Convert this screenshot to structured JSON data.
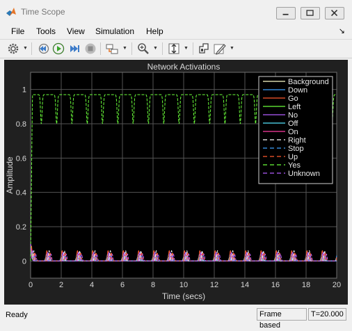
{
  "window": {
    "title": "Time Scope",
    "minimize_icon": "minimize-icon",
    "maximize_icon": "maximize-icon",
    "close_icon": "close-icon"
  },
  "menu": {
    "items": [
      "File",
      "Tools",
      "View",
      "Simulation",
      "Help"
    ],
    "overflow_icon": "dock-arrow-icon"
  },
  "toolbar": {
    "icons": [
      "gear-icon",
      "step-back-icon",
      "run-icon",
      "step-forward-icon",
      "stop-icon",
      "signal-selection-icon",
      "zoom-icon",
      "scale-axes-icon",
      "highlight-simulink-icon",
      "edit-icon"
    ]
  },
  "status": {
    "left": "Ready",
    "mode": "Frame based",
    "time": "T=20.000"
  },
  "colors": {
    "background": "#202020",
    "plot": "#000000",
    "grid": "#545454",
    "axis_text": "#d8d8d8"
  },
  "chart_data": {
    "type": "line",
    "title": "Network Activations",
    "xlabel": "Time (secs)",
    "ylabel": "Amplitude",
    "xlim": [
      0,
      20
    ],
    "ylim": [
      -0.1,
      1.1
    ],
    "xticks": [
      "0",
      "2",
      "4",
      "6",
      "8",
      "10",
      "12",
      "14",
      "16",
      "18",
      "20"
    ],
    "yticks": [
      "0",
      "0.2",
      "0.4",
      "0.6",
      "0.8",
      "1"
    ],
    "grid": true,
    "legend_position": "top-right",
    "series": [
      {
        "name": "Background",
        "color": "#ffffcc",
        "dash": false
      },
      {
        "name": "Down",
        "color": "#3fa3ff",
        "dash": false
      },
      {
        "name": "Go",
        "color": "#ff5a2d",
        "dash": false
      },
      {
        "name": "Left",
        "color": "#6bff3a",
        "dash": false
      },
      {
        "name": "No",
        "color": "#b35cff",
        "dash": false
      },
      {
        "name": "Off",
        "color": "#55e7ff",
        "dash": false
      },
      {
        "name": "On",
        "color": "#ff3da4",
        "dash": false
      },
      {
        "name": "Right",
        "color": "#ffffff",
        "dash": true
      },
      {
        "name": "Stop",
        "color": "#3fa3ff",
        "dash": true
      },
      {
        "name": "Up",
        "color": "#ff5a2d",
        "dash": true
      },
      {
        "name": "Yes",
        "color": "#6bff3a",
        "dash": true
      },
      {
        "name": "Unknown",
        "color": "#b35cff",
        "dash": true
      }
    ],
    "yes_activation": {
      "plateau": 0.97,
      "dip": 0.8,
      "dip_period": 1.0,
      "dip_start": 0.2
    },
    "spike_activation": {
      "peak": 0.06,
      "period": 1.0,
      "start": 0.5
    }
  }
}
